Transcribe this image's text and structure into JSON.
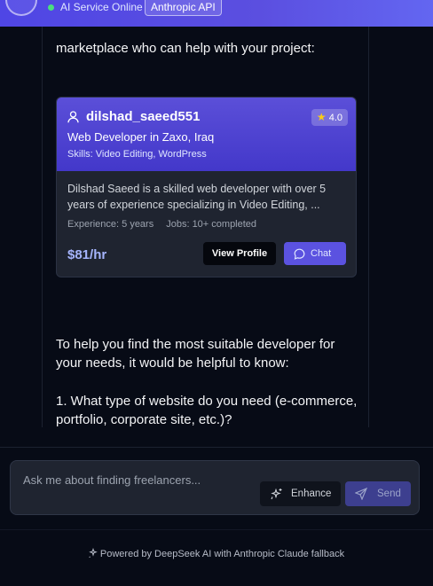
{
  "header": {
    "status_text": "AI Service Online",
    "api_badge": "Anthropic API",
    "status_color": "#4ade80"
  },
  "chat": {
    "intro_fragment": "marketplace who can help with your project:",
    "followup_paragraph": "To help you find the most suitable developer for your needs, it would be helpful to know:",
    "question_1": "1. What type of website do you need (e-commerce, portfolio, corporate site, etc.)?"
  },
  "freelancer_card": {
    "icon": "user-icon",
    "username": "dilshad_saeed551",
    "rating": "4.0",
    "title": "Web Developer in Zaxo, Iraq",
    "skills": "Skills: Video Editing, WordPress",
    "description": "Dilshad Saeed is a skilled web developer with over 5 years of experience specializing in Video Editing, ...",
    "experience": "Experience: 5 years",
    "jobs": "Jobs: 10+ completed",
    "rate": "$81/hr",
    "view_profile_label": "View Profile",
    "chat_label": "Chat",
    "accent_color": "#4f46e5"
  },
  "composer": {
    "placeholder": "Ask me about finding freelancers...",
    "enhance_label": "Enhance",
    "send_label": "Send"
  },
  "footer": {
    "text": "Powered by DeepSeek AI with Anthropic Claude fallback"
  }
}
